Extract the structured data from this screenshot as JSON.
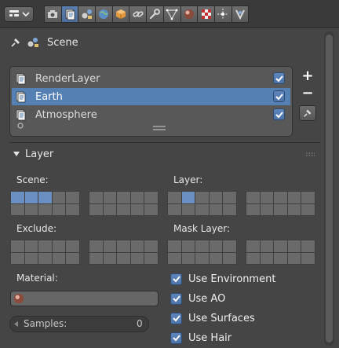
{
  "header": {
    "editor_type_icon": "properties-editor-icon",
    "tabs": [
      {
        "name": "render-tab",
        "icon": "camera-icon",
        "active": false
      },
      {
        "name": "render-layers-tab",
        "icon": "render-layers-icon",
        "active": true
      },
      {
        "name": "scene-tab",
        "icon": "scene-icon",
        "active": false
      },
      {
        "name": "world-tab",
        "icon": "world-icon",
        "active": false
      },
      {
        "name": "object-tab",
        "icon": "cube-icon",
        "active": false
      },
      {
        "name": "constraints-tab",
        "icon": "link-icon",
        "active": false
      },
      {
        "name": "modifiers-tab",
        "icon": "wrench-icon",
        "active": false
      },
      {
        "name": "data-tab",
        "icon": "mesh-data-icon",
        "active": false
      },
      {
        "name": "material-tab",
        "icon": "material-sphere-icon",
        "active": false
      },
      {
        "name": "texture-tab",
        "icon": "checker-texture-icon",
        "active": false
      },
      {
        "name": "particles-tab",
        "icon": "particles-icon",
        "active": false
      },
      {
        "name": "physics-tab",
        "icon": "physics-icon",
        "active": false
      }
    ]
  },
  "context": {
    "label": "Scene",
    "pin_icon": "pin-icon",
    "scene_icon": "scene-icon"
  },
  "layer_list": {
    "rows": [
      {
        "label": "RenderLayer",
        "enabled": true,
        "selected": false
      },
      {
        "label": "Earth",
        "enabled": true,
        "selected": true
      },
      {
        "label": "Atmosphere",
        "enabled": true,
        "selected": false
      }
    ],
    "add_label": "+",
    "remove_label": "−"
  },
  "panel": {
    "title": "Layer",
    "scene_label": "Scene:",
    "layer_label": "Layer:",
    "exclude_label": "Exclude:",
    "mask_label": "Mask Layer:",
    "material_label": "Material:",
    "samples_label": "Samples:",
    "samples_value": "0"
  },
  "use_options": [
    {
      "label": "Use Environment",
      "checked": true
    },
    {
      "label": "Use AO",
      "checked": true
    },
    {
      "label": "Use Surfaces",
      "checked": true
    },
    {
      "label": "Use Hair",
      "checked": true
    }
  ],
  "layer_states": {
    "scene_on": [
      0,
      1,
      2
    ],
    "layer_on": [
      1
    ],
    "exclude_on": [],
    "mask_on": []
  },
  "colors": {
    "accent": "#5580b3",
    "checkbox": "#5f86bc",
    "panel_bg": "#454545"
  }
}
